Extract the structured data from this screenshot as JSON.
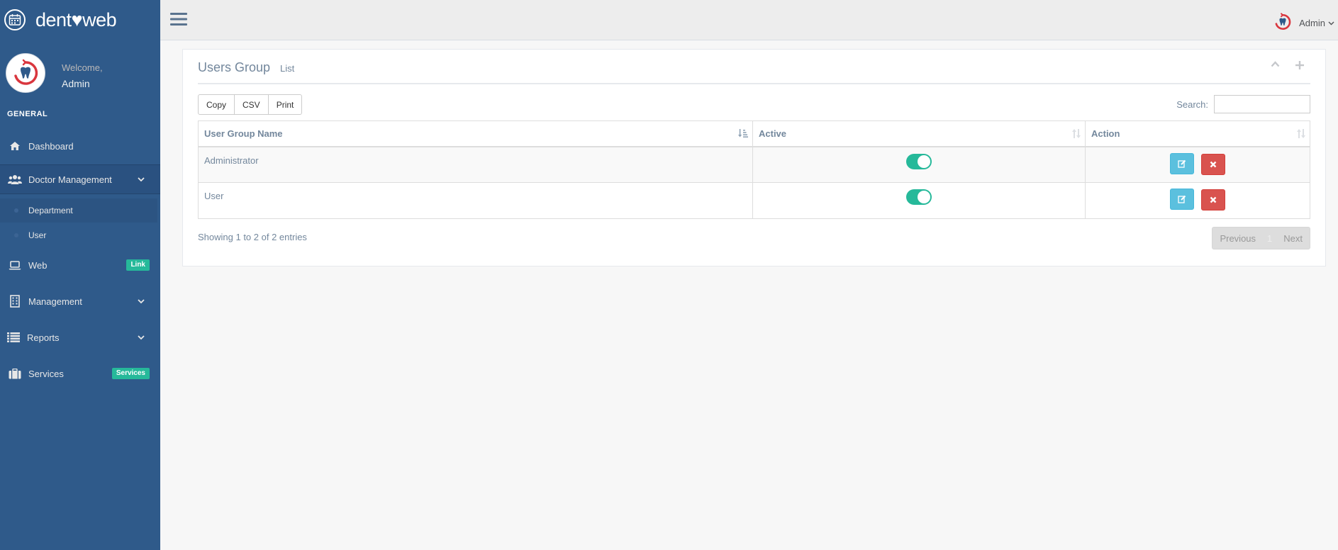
{
  "brand": {
    "name": "dent♥web"
  },
  "profile": {
    "welcome": "Welcome,",
    "name": "Admin"
  },
  "sidebar": {
    "section_title": "GENERAL",
    "items": [
      {
        "label": "Dashboard",
        "icon": "home-icon"
      },
      {
        "label": "Doctor Management",
        "icon": "users-icon",
        "expanded": true,
        "children": [
          {
            "label": "Department",
            "active": true
          },
          {
            "label": "User"
          }
        ]
      },
      {
        "label": "Web",
        "icon": "laptop-icon",
        "badge": "Link"
      },
      {
        "label": "Management",
        "icon": "building-icon"
      },
      {
        "label": "Reports",
        "icon": "list-icon"
      },
      {
        "label": "Services",
        "icon": "briefcase-icon",
        "badge": "Services"
      }
    ]
  },
  "topbar": {
    "user": "Admin"
  },
  "panel": {
    "title": "Users Group",
    "subtitle": "List",
    "buttons": {
      "copy": "Copy",
      "csv": "CSV",
      "print": "Print"
    },
    "search": {
      "label": "Search:",
      "value": ""
    },
    "table": {
      "columns": [
        "User Group Name",
        "Active",
        "Action"
      ],
      "rows": [
        {
          "name": "Administrator",
          "active": true
        },
        {
          "name": "User",
          "active": true
        }
      ]
    },
    "info": "Showing 1 to 2 of 2 entries",
    "pagination": {
      "previous": "Previous",
      "current": "1",
      "next": "Next"
    }
  },
  "colors": {
    "sidebar_bg": "#2F5A8A",
    "toggle_on": "#26B99A",
    "edit_btn": "#5BC0DE",
    "delete_btn": "#D9534F",
    "badge": "#26B99A"
  }
}
